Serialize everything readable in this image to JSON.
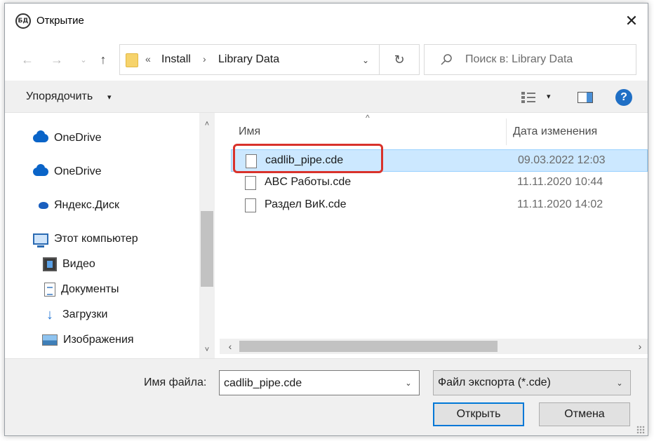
{
  "window": {
    "app_icon_text": "БД",
    "title": "Открытие",
    "close_glyph": "✕"
  },
  "navigation": {
    "back_glyph": "←",
    "forward_glyph": "→",
    "recent_glyph": "⌄",
    "up_glyph": "↑",
    "breadcrumb": {
      "overflow": "«",
      "items": [
        "Install",
        "Library Data"
      ],
      "separator": "›"
    },
    "address_dropdown_glyph": "⌄",
    "refresh_glyph": "↻",
    "search_placeholder": "Поиск в: Library Data"
  },
  "toolbar": {
    "organize_label": "Упорядочить",
    "organize_caret": "▾",
    "view_caret": "▾",
    "help_glyph": "?"
  },
  "nav_pane": {
    "items": [
      {
        "label": "OneDrive",
        "icon": "onedrive-icon"
      },
      {
        "label": "OneDrive",
        "icon": "onedrive-icon"
      },
      {
        "label": "Яндекс.Диск",
        "icon": "yandex-disk-icon"
      },
      {
        "label": "Этот компьютер",
        "icon": "computer-icon"
      },
      {
        "label": "Видео",
        "icon": "video-folder-icon"
      },
      {
        "label": "Документы",
        "icon": "documents-folder-icon"
      },
      {
        "label": "Загрузки",
        "icon": "downloads-folder-icon"
      },
      {
        "label": "Изображения",
        "icon": "pictures-folder-icon"
      }
    ],
    "scroll_up_glyph": "˄",
    "scroll_down_glyph": "˅"
  },
  "file_list": {
    "sort_glyph": "^",
    "columns": {
      "name": "Имя",
      "date": "Дата изменения"
    },
    "rows": [
      {
        "name": "cadlib_pipe.cde",
        "date": "09.03.2022 12:03",
        "selected": true
      },
      {
        "name": "ABC Работы.cde",
        "date": "11.11.2020 10:44",
        "selected": false
      },
      {
        "name": "Раздел ВиК.cde",
        "date": "11.11.2020 14:02",
        "selected": false
      }
    ],
    "hscroll_left_glyph": "‹",
    "hscroll_right_glyph": "›"
  },
  "bottom": {
    "filename_label": "Имя файла:",
    "filename_value": "cadlib_pipe.cde",
    "filename_caret": "⌄",
    "filetype_value": "Файл экспорта (*.cde)",
    "filetype_caret": "⌄",
    "open_label": "Открыть",
    "cancel_label": "Отмена"
  },
  "colors": {
    "selection_bg": "#cce8ff",
    "highlight_box": "#d9322b",
    "accent": "#0078d7"
  }
}
